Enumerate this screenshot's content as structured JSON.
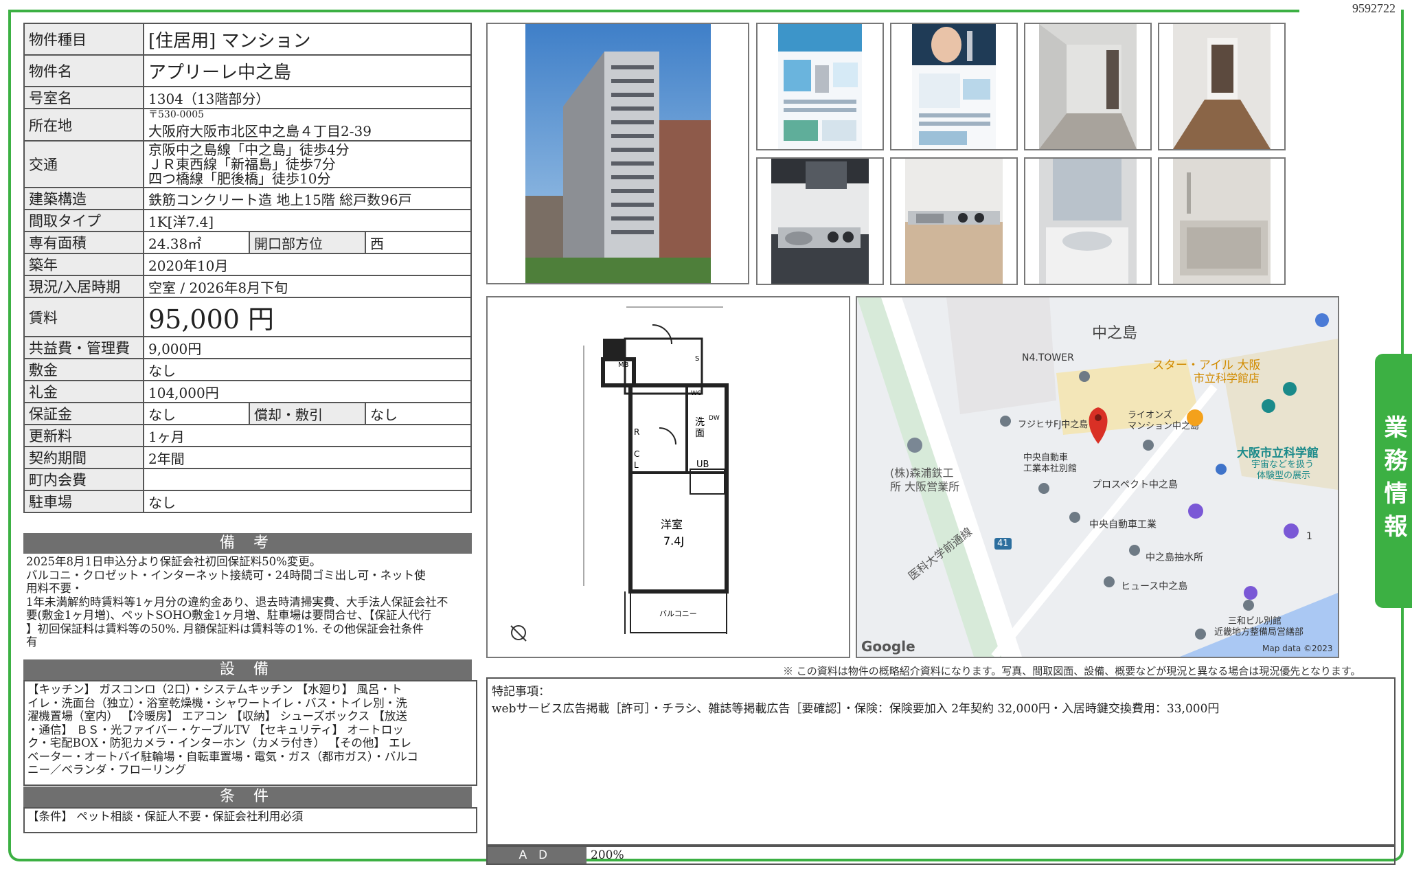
{
  "doc_id": "9592722",
  "side_tab": "業務情報",
  "property": {
    "type_label": "物件種目",
    "type_value": "[住居用] マンション",
    "name_label": "物件名",
    "name_value": "アプリーレ中之島",
    "room_label": "号室名",
    "room_value": "1304（13階部分）",
    "address_label": "所在地",
    "postal": "〒530-0005",
    "address_value": "大阪府大阪市北区中之島４丁目2-39",
    "access_label": "交通",
    "access": [
      "京阪中之島線「中之島」徒歩4分",
      "ＪＲ東西線「新福島」徒歩7分",
      "四つ橋線「肥後橋」徒歩10分"
    ],
    "structure_label": "建築構造",
    "structure_value": "鉄筋コンクリート造 地上15階 総戸数96戸",
    "layout_label": "間取タイプ",
    "layout_value": "1K[洋7.4]",
    "area_label": "専有面積",
    "area_value": "24.38㎡",
    "facing_label": "開口部方位",
    "facing_value": "西",
    "built_label": "築年",
    "built_value": "2020年10月",
    "status_label": "現況/入居時期",
    "status_value": "空室 / 2026年8月下旬",
    "rent_label": "賃料",
    "rent_value": "95,000 円",
    "fee_label": "共益費・管理費",
    "fee_value": "9,000円",
    "deposit_label": "敷金",
    "deposit_value": "なし",
    "key_money_label": "礼金",
    "key_money_value": "104,000円",
    "guarantee_label": "保証金",
    "guarantee_value": "なし",
    "amort_label": "償却・敷引",
    "amort_value": "なし",
    "renewal_label": "更新料",
    "renewal_value": "1ヶ月",
    "contract_label": "契約期間",
    "contract_value": "2年間",
    "assoc_label": "町内会費",
    "assoc_value": "",
    "parking_label": "駐車場",
    "parking_value": "なし"
  },
  "remarks": {
    "heading": "備 考",
    "lines": [
      "2025年8月1日申込分より保証会社初回保証料50%変更。",
      "バルコニ・クロゼット・インターネット接続可・24時間ゴミ出し可・ネット使",
      "用料不要・",
      "1年未満解約時賃料等1ヶ月分の違約金あり、退去時清掃実費、大手法人保証会社不",
      "要(敷金1ヶ月増)、ペットSOHO敷金1ヶ月増、駐車場は要問合せ、【保証人代行",
      "】初回保証料は賃料等の50%. 月額保証料は賃料等の1%. その他保証会社条件",
      "有"
    ]
  },
  "equipment": {
    "heading": "設 備",
    "lines": [
      "【キッチン】 ガスコンロ（2口）・システムキッチン 【水廻り】 風呂・ト",
      "イレ・洗面台（独立）・浴室乾燥機・シャワートイレ・バス・トイレ別・洗",
      "濯機置場（室内） 【冷暖房】 エアコン 【収納】 シューズボックス 【放送",
      "・通信】 ＢＳ・光ファイバー・ケーブルTV 【セキュリティ】 オートロッ",
      "ク・宅配BOX・防犯カメラ・インターホン（カメラ付き） 【その他】 エレ",
      "ベーター・オートバイ駐輪場・自転車置場・電気・ガス（都市ガス）・バルコ",
      "ニー／ベランダ・フローリング"
    ]
  },
  "conditions": {
    "heading": "条 件",
    "text": "【条件】 ペット相談・保証人不要・保証会社利用必須"
  },
  "floorplan": {
    "room_label": "洋室",
    "room_size": "7.4J",
    "balcony": "バルコニー",
    "labels": [
      "MB",
      "S",
      "R",
      "C",
      "L",
      "洗",
      "面",
      "UB",
      "WC",
      "DW"
    ]
  },
  "map": {
    "labels": {
      "area": "中之島",
      "n4": "N4.TOWER",
      "star_island": "スター・アイル 大阪",
      "science_mus_sub": "市立科学館店",
      "fujihisa": "フジヒサFJ中之島ビル",
      "lions": "ライオンズ",
      "lions2": "マンション中之島",
      "morikawa1": "(株)森浦鉄工",
      "morikawa2": "所 大阪営業所",
      "chuo_annex1": "中央自動車",
      "chuo_annex2": "工業本社別館",
      "prospect": "プロスペクト中之島",
      "science1": "大阪市立科学館",
      "science2": "宇宙などを扱う",
      "science3": "体験型の展示",
      "chuo": "中央自動車工業",
      "pump": "中之島抽水所",
      "hugh": "ヒュース中之島",
      "road": "医科大学前通線",
      "route": "41",
      "sanwa1": "三和ビル別館",
      "sanwa2": "近畿地方整備局営繕部",
      "google": "Google",
      "mapdata": "Map data ©2023",
      "one": "1"
    }
  },
  "caption": "※ この資料は物件の概略紹介資料になります。写真、間取図面、設備、概要などが現況と異なる場合は現況優先となります。",
  "notes": {
    "title": "特記事項：",
    "text": "webサービス広告掲載［許可］・チラシ、雑誌等掲載広告［要確認］・保険：保険要加入 2年契約 32,000円・入居時鍵交換費用：33,000円"
  },
  "ad": {
    "label": "ＡＤ",
    "value": "200%"
  },
  "colors": {
    "frame": "#3cb043",
    "header": "#6f6f6f",
    "pin": "#d93025"
  }
}
